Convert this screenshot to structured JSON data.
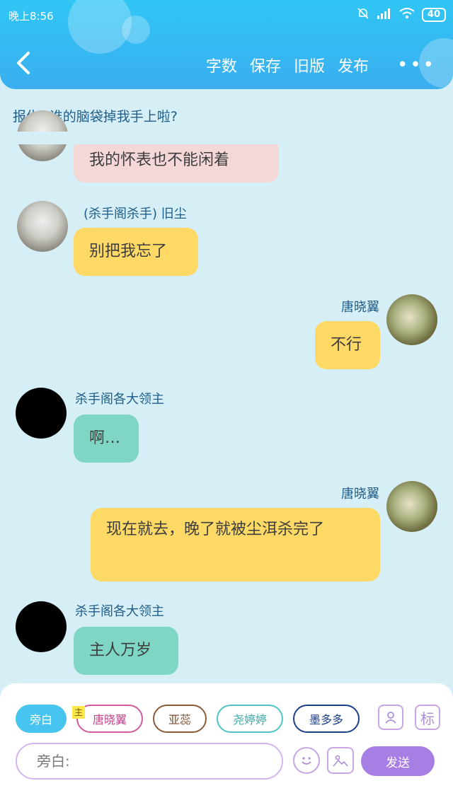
{
  "status_bar": {
    "time": "晚上8:56",
    "battery": "40"
  },
  "toolbar": {
    "word_count": "字数",
    "save": "保存",
    "old_version": "旧版",
    "publish": "发布"
  },
  "topic": "报仇--谁的脑袋掉我手上啦?",
  "messages": [
    {
      "text": "我的怀表也不能闲着"
    },
    {
      "sender": "(杀手阁杀手) 旧尘",
      "text": "别把我忘了"
    },
    {
      "sender": "唐晓翼",
      "text": "不行"
    },
    {
      "sender": "杀手阁各大领主",
      "text": "啊…"
    },
    {
      "sender": "唐晓翼",
      "text": "现在就去，晚了就被尘洱杀完了"
    },
    {
      "sender": "杀手阁各大领主",
      "text": "主人万岁"
    }
  ],
  "roles": [
    {
      "label": "旁白"
    },
    {
      "label": "唐晓翼",
      "tag": "主"
    },
    {
      "label": "亚蕊"
    },
    {
      "label": "尧婷婷"
    },
    {
      "label": "墨多多"
    }
  ],
  "tools": {
    "mark": "标"
  },
  "input": {
    "placeholder": "旁白:"
  },
  "send_label": "发送"
}
